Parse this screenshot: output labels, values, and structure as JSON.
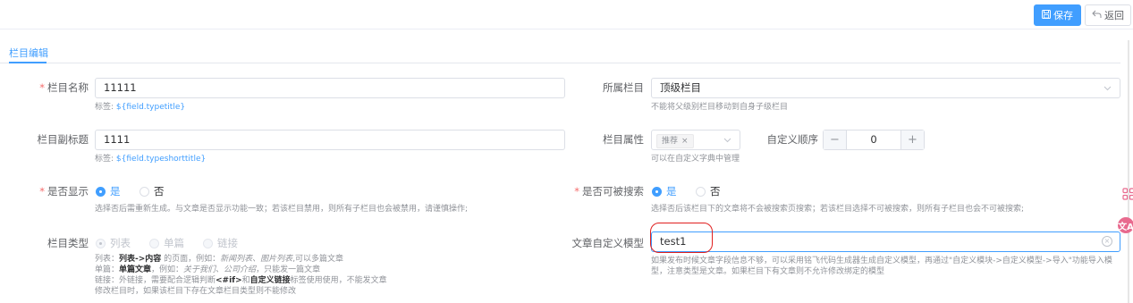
{
  "toolbar": {
    "save_label": "保存",
    "back_label": "返回"
  },
  "tabs": {
    "active_label": "栏目编辑"
  },
  "form": {
    "typename": {
      "required": "*",
      "label": "栏目名称",
      "value": "11111",
      "hint_prefix": "标签:",
      "hint_tag": "${field.typetitle}"
    },
    "parent": {
      "label": "所属栏目",
      "value": "顶级栏目",
      "hint": "不能将父级别栏目移动到自身子级栏目"
    },
    "subtitle": {
      "label": "栏目副标题",
      "value": "1111",
      "hint_prefix": "标签:",
      "hint_tag": "${field.typeshorttitle}"
    },
    "attribute": {
      "label": "栏目属性",
      "tag": "推荐",
      "tag_close": "×",
      "hint": "可以在自定义字典中管理"
    },
    "order": {
      "label": "自定义顺序",
      "minus": "−",
      "value": "0",
      "plus": "+"
    },
    "display": {
      "required": "*",
      "label": "是否显示",
      "opt_yes": "是",
      "opt_no": "否",
      "selected": "是",
      "hint": "选择否后需重新生成。与文章是否显示功能一致；若该栏目禁用，则所有子栏目也会被禁用，请谨慎操作;"
    },
    "searchable": {
      "required": "*",
      "label": "是否可被搜索",
      "opt_yes": "是",
      "opt_no": "否",
      "selected": "是",
      "hint": "选择否后该栏目下的文章将不会被搜索页搜索；若该栏目选择不可被搜索，则所有子栏目也会不可被搜索;"
    },
    "column_type": {
      "label": "栏目类型",
      "opt_list": "列表",
      "opt_single": "单篇",
      "opt_link": "链接",
      "selected": "列表",
      "hint_l1_a": "列表：",
      "hint_l1_b": "列表->内容",
      "hint_l1_c": " 的页面，例如：",
      "hint_l1_d": "新闻列表、图片列表",
      "hint_l1_e": ",可以多篇文章",
      "hint_l2_a": "单篇：",
      "hint_l2_b": "单篇文章",
      "hint_l2_c": "，例如：",
      "hint_l2_d": "关于我们、公司介绍",
      "hint_l2_e": "，只能发一篇文章",
      "hint_l3_a": "链接：外链接，需要配合逻辑判断",
      "hint_l3_b": "<#if>",
      "hint_l3_c": "和",
      "hint_l3_d": "自定义链接",
      "hint_l3_e": "标签使用使用，不能发文章",
      "hint_l4": "修改栏目时，如果该栏目下存在文章栏目类型则不能修改"
    },
    "custom_model": {
      "label": "文章自定义模型",
      "value": "test1",
      "clear_icon": "×",
      "hint_l1": "如果发布时候文章字段信息不够，可以采用铭飞代码生成器生成自定义模型，再通过\"自定义模块->自定义模型->导入\"功能导入模",
      "hint_l2": "型，注意类型是文章。如果栏目下有文章则不允许修改绑定的模型"
    }
  },
  "float_tools": {
    "translate_glyph": "文A"
  }
}
